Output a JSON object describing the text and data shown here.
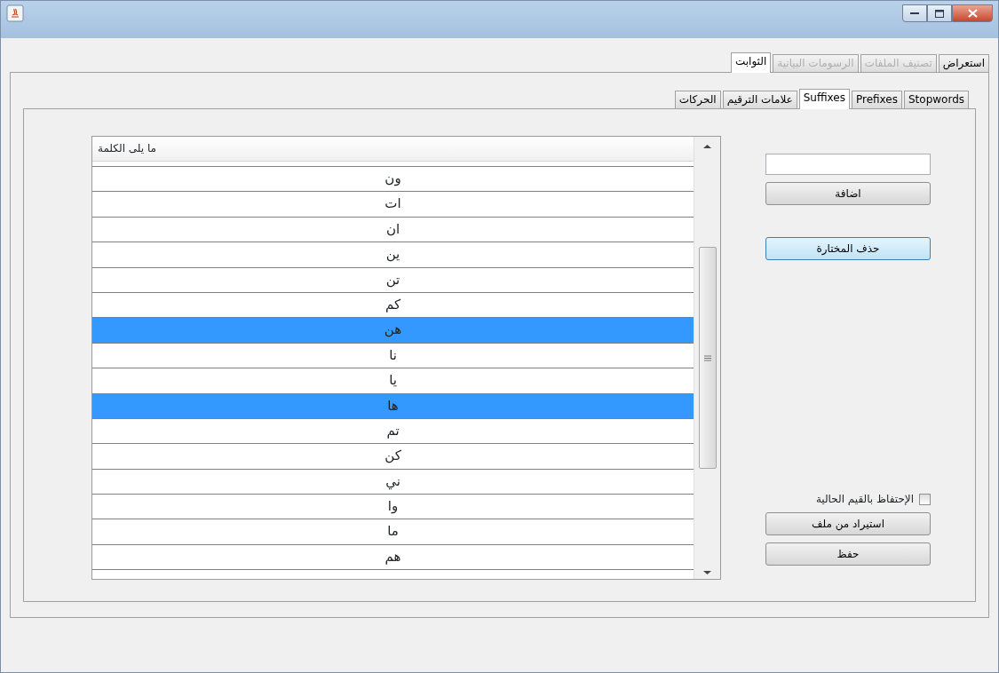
{
  "main_tabs": [
    {
      "label": "استعراض",
      "selected": false,
      "disabled": false
    },
    {
      "label": "تصنيف الملفات",
      "selected": false,
      "disabled": true
    },
    {
      "label": "الرسومات البيانية",
      "selected": false,
      "disabled": true
    },
    {
      "label": "الثوابت",
      "selected": true,
      "disabled": false
    }
  ],
  "sub_tabs": [
    {
      "label": "Stopwords",
      "selected": false
    },
    {
      "label": "Prefixes",
      "selected": false
    },
    {
      "label": "Suffixes",
      "selected": true
    },
    {
      "label": "علامات الترقيم",
      "selected": false
    },
    {
      "label": "الحركات",
      "selected": false
    }
  ],
  "table": {
    "columns": [
      "ما يلى الكلمة"
    ],
    "rows": [
      {
        "text": "ون",
        "selected": false
      },
      {
        "text": "ات",
        "selected": false
      },
      {
        "text": "ان",
        "selected": false
      },
      {
        "text": "ين",
        "selected": false
      },
      {
        "text": "تن",
        "selected": false
      },
      {
        "text": "كم",
        "selected": false
      },
      {
        "text": "هن",
        "selected": true
      },
      {
        "text": "نا",
        "selected": false
      },
      {
        "text": "يا",
        "selected": false
      },
      {
        "text": "ها",
        "selected": true
      },
      {
        "text": "تم",
        "selected": false
      },
      {
        "text": "كن",
        "selected": false
      },
      {
        "text": "ني",
        "selected": false
      },
      {
        "text": "وا",
        "selected": false
      },
      {
        "text": "ما",
        "selected": false
      },
      {
        "text": "هم",
        "selected": false
      }
    ]
  },
  "top_buttons": [
    {
      "label": "اضافة",
      "highlighted": false
    },
    {
      "label": "حذف المختارة",
      "highlighted": true
    }
  ],
  "keep_values": {
    "label": "الإحتفاظ بالقيم الحالية",
    "checked": false
  },
  "bottom_buttons": [
    {
      "label": "استيراد من ملف",
      "highlighted": false
    },
    {
      "label": "حفظ",
      "highlighted": false
    }
  ]
}
